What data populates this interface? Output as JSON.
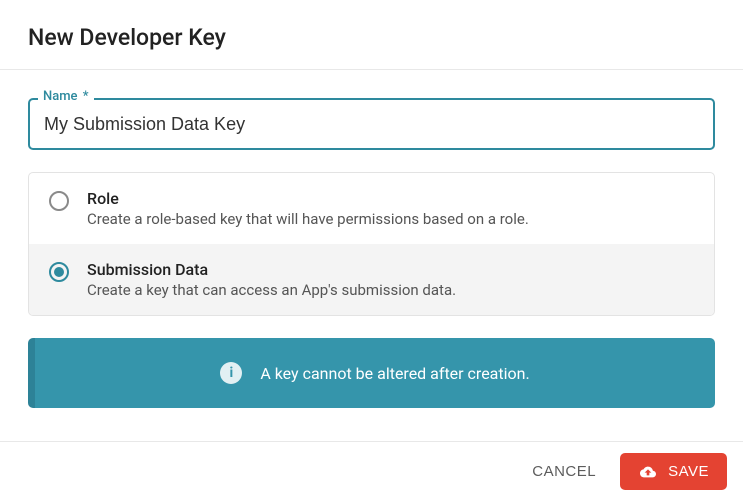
{
  "header": {
    "title": "New Developer Key"
  },
  "form": {
    "name_label": "Name",
    "required_mark": "*",
    "name_value": "My Submission Data Key"
  },
  "options": {
    "role": {
      "title": "Role",
      "desc": "Create a role-based key that will have permissions based on a role."
    },
    "submission": {
      "title": "Submission Data",
      "desc": "Create a key that can access an App's submission data."
    }
  },
  "banner": {
    "text": "A key cannot be altered after creation."
  },
  "footer": {
    "cancel": "CANCEL",
    "save": "SAVE"
  }
}
